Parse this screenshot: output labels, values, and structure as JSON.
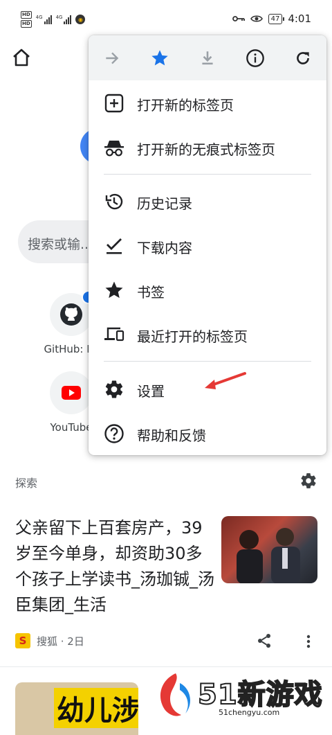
{
  "status_bar": {
    "hd1": "HD",
    "hd2": "HD",
    "net1": "4G",
    "net2": "4G",
    "battery": "47",
    "time": "4:01"
  },
  "background_page": {
    "search_placeholder": "搜索或输...",
    "tiles": [
      {
        "label": "GitHub: Le",
        "icon": "github-icon"
      },
      {
        "label": "YouTube",
        "icon": "youtube-icon"
      }
    ],
    "explore_label": "探索",
    "article": {
      "title": "父亲留下上百套房产，39岁至今单身，却资助30多个孩子上学读书_汤珈铖_汤臣集团_生活",
      "source_logo": "S",
      "source": "搜狐 · 2日"
    },
    "article2_thumb_text": "幼儿涉"
  },
  "menu": {
    "toolbar": [
      {
        "icon": "forward-arrow-icon",
        "enabled": false
      },
      {
        "icon": "star-filled-icon",
        "color": "#1a73e8"
      },
      {
        "icon": "download-icon",
        "enabled": false
      },
      {
        "icon": "info-icon"
      },
      {
        "icon": "refresh-icon"
      }
    ],
    "items": [
      {
        "label": "打开新的标签页",
        "icon": "new-tab-icon"
      },
      {
        "label": "打开新的无痕式标签页",
        "icon": "incognito-icon"
      },
      {
        "label": "历史记录",
        "icon": "history-icon"
      },
      {
        "label": "下载内容",
        "icon": "downloads-icon"
      },
      {
        "label": "书签",
        "icon": "bookmarks-star-icon"
      },
      {
        "label": "最近打开的标签页",
        "icon": "recent-tabs-icon"
      },
      {
        "label": "设置",
        "icon": "settings-gear-icon"
      },
      {
        "label": "帮助和反馈",
        "icon": "help-icon"
      }
    ]
  },
  "watermark": {
    "brand": "51新游戏",
    "url": "51chengyu.com"
  },
  "colors": {
    "accent_blue": "#1a73e8",
    "annotation_red": "#e53935",
    "menu_toolbar_bg": "#f1f3f4"
  }
}
